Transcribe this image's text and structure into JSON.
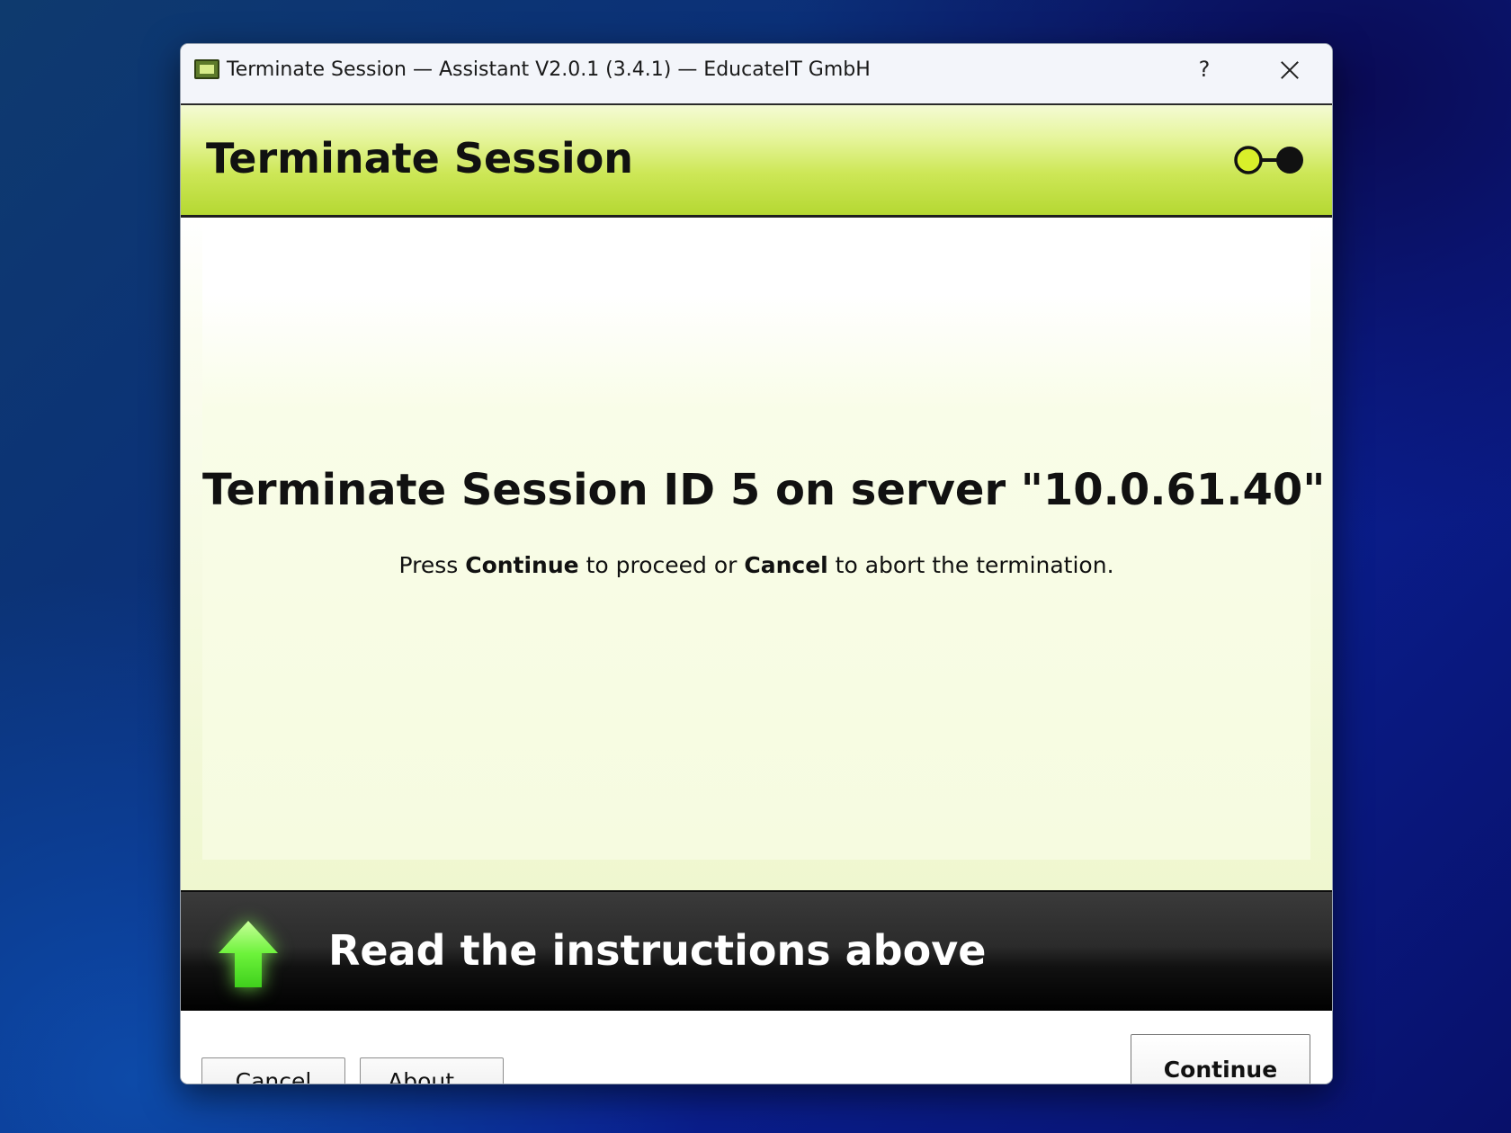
{
  "window": {
    "title": "Terminate Session — Assistant V2.0.1 (3.4.1) — EducateIT GmbH",
    "help_label": "?",
    "app_icon": "calculator-screen-icon",
    "close_icon": "close-icon"
  },
  "header": {
    "title": "Terminate Session",
    "step_indicator": "step-indicator-icon",
    "accent_color": "#c8e44a"
  },
  "content": {
    "heading": "Terminate Session ID 5 on server \"10.0.61.40\"",
    "instruction_prefix": "Press ",
    "instruction_continue": "Continue",
    "instruction_middle": " to proceed or ",
    "instruction_cancel": "Cancel",
    "instruction_suffix": " to abort the termination."
  },
  "banner": {
    "text": "Read the instructions above",
    "icon": "up-arrow-icon",
    "icon_color": "#7dff3a"
  },
  "footer": {
    "cancel_label": "Cancel",
    "about_label": "About...",
    "continue_label": "Continue"
  }
}
